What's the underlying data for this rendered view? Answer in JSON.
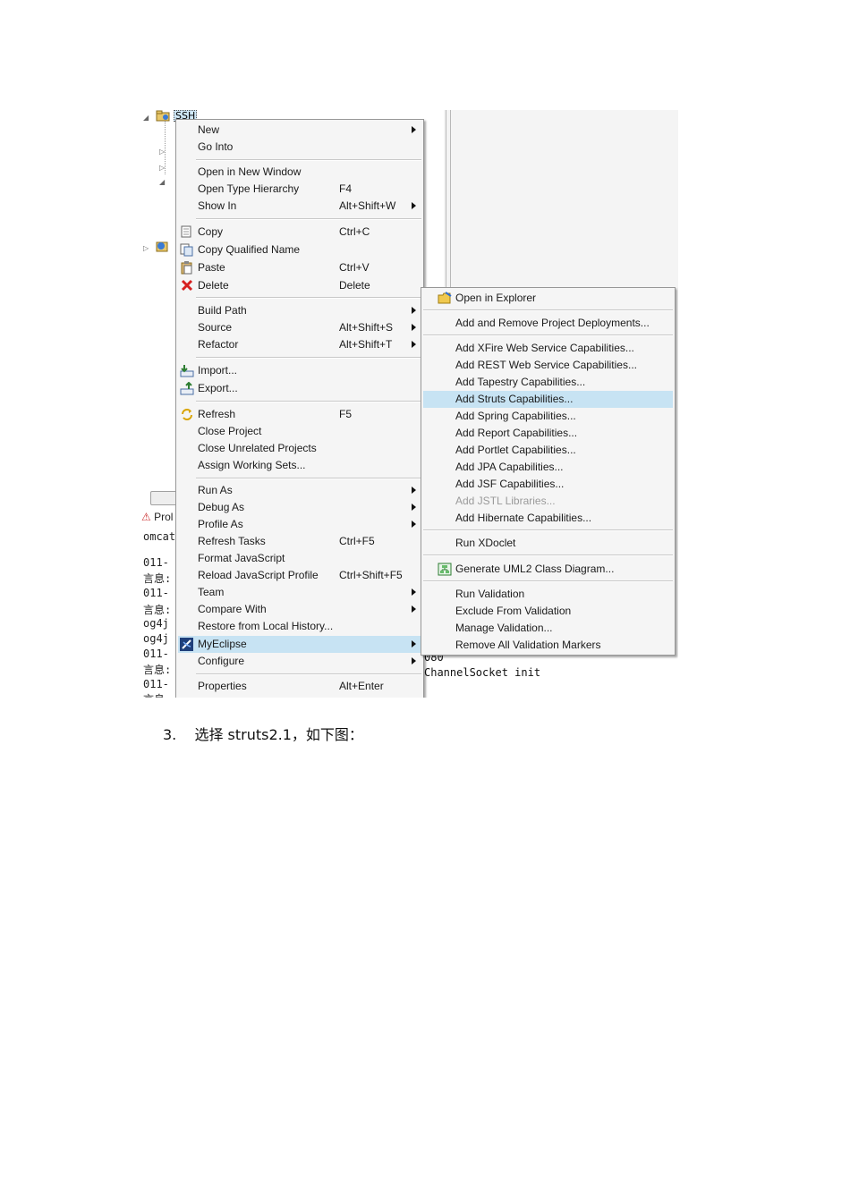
{
  "tree": {
    "project_label": "SSH"
  },
  "console_left": [
    "omcat6",
    "011-",
    "言息:",
    "011-",
    "言息:",
    "og4j",
    "og4j",
    "011-",
    "言息:",
    "011-",
    "言息"
  ],
  "console_right": [
    "080",
    "ChannelSocket init"
  ],
  "tabs": {
    "problems_label": "Prol"
  },
  "context_menu": {
    "items": [
      {
        "label": "New",
        "shortcut": "",
        "submenu": true
      },
      {
        "label": "Go Into",
        "shortcut": ""
      },
      {
        "label": "Open in New Window",
        "shortcut": ""
      },
      {
        "label": "Open Type Hierarchy",
        "shortcut": "F4"
      },
      {
        "label": "Show In",
        "shortcut": "Alt+Shift+W",
        "submenu": true
      },
      {
        "label": "Copy",
        "shortcut": "Ctrl+C",
        "icon": "copy-icon"
      },
      {
        "label": "Copy Qualified Name",
        "shortcut": "",
        "icon": "copy-qualified-icon"
      },
      {
        "label": "Paste",
        "shortcut": "Ctrl+V",
        "icon": "paste-icon"
      },
      {
        "label": "Delete",
        "shortcut": "Delete",
        "icon": "delete-icon"
      },
      {
        "label": "Build Path",
        "shortcut": "",
        "submenu": true
      },
      {
        "label": "Source",
        "shortcut": "Alt+Shift+S",
        "submenu": true
      },
      {
        "label": "Refactor",
        "shortcut": "Alt+Shift+T",
        "submenu": true
      },
      {
        "label": "Import...",
        "shortcut": "",
        "icon": "import-icon"
      },
      {
        "label": "Export...",
        "shortcut": "",
        "icon": "export-icon"
      },
      {
        "label": "Refresh",
        "shortcut": "F5",
        "icon": "refresh-icon"
      },
      {
        "label": "Close Project",
        "shortcut": ""
      },
      {
        "label": "Close Unrelated Projects",
        "shortcut": ""
      },
      {
        "label": "Assign Working Sets...",
        "shortcut": ""
      },
      {
        "label": "Run As",
        "shortcut": "",
        "submenu": true
      },
      {
        "label": "Debug As",
        "shortcut": "",
        "submenu": true
      },
      {
        "label": "Profile As",
        "shortcut": "",
        "submenu": true
      },
      {
        "label": "Refresh Tasks",
        "shortcut": "Ctrl+F5"
      },
      {
        "label": "Format JavaScript",
        "shortcut": ""
      },
      {
        "label": "Reload JavaScript Profile",
        "shortcut": "Ctrl+Shift+F5"
      },
      {
        "label": "Team",
        "shortcut": "",
        "submenu": true
      },
      {
        "label": "Compare With",
        "shortcut": "",
        "submenu": true
      },
      {
        "label": "Restore from Local History...",
        "shortcut": ""
      },
      {
        "label": "MyEclipse",
        "shortcut": "",
        "submenu": true,
        "icon": "myeclipse-icon",
        "highlighted": true
      },
      {
        "label": "Configure",
        "shortcut": "",
        "submenu": true
      },
      {
        "label": "Properties",
        "shortcut": "Alt+Enter"
      }
    ]
  },
  "myeclipse_submenu": {
    "items": [
      {
        "label": "Open in Explorer",
        "icon": "open-folder-icon"
      },
      {
        "label": "Add and Remove Project Deployments..."
      },
      {
        "label": "Add XFire Web Service Capabilities..."
      },
      {
        "label": "Add REST Web Service Capabilities..."
      },
      {
        "label": "Add Tapestry Capabilities..."
      },
      {
        "label": "Add Struts Capabilities...",
        "highlighted": true
      },
      {
        "label": "Add Spring Capabilities..."
      },
      {
        "label": "Add Report Capabilities..."
      },
      {
        "label": "Add Portlet Capabilities..."
      },
      {
        "label": "Add JPA Capabilities..."
      },
      {
        "label": "Add JSF Capabilities..."
      },
      {
        "label": "Add JSTL Libraries...",
        "disabled": true
      },
      {
        "label": "Add Hibernate Capabilities..."
      },
      {
        "label": "Run XDoclet"
      },
      {
        "label": "Generate UML2 Class Diagram...",
        "icon": "uml-diagram-icon"
      },
      {
        "label": "Run Validation"
      },
      {
        "label": "Exclude From Validation"
      },
      {
        "label": "Manage Validation..."
      },
      {
        "label": "Remove All Validation Markers"
      }
    ]
  },
  "caption": {
    "number": "3.",
    "text": "选择 struts2.1，如下图："
  },
  "colors": {
    "menu_bg": "#f5f5f5",
    "highlight": "#c7e3f3",
    "disabled_text": "#9a9a9a"
  }
}
